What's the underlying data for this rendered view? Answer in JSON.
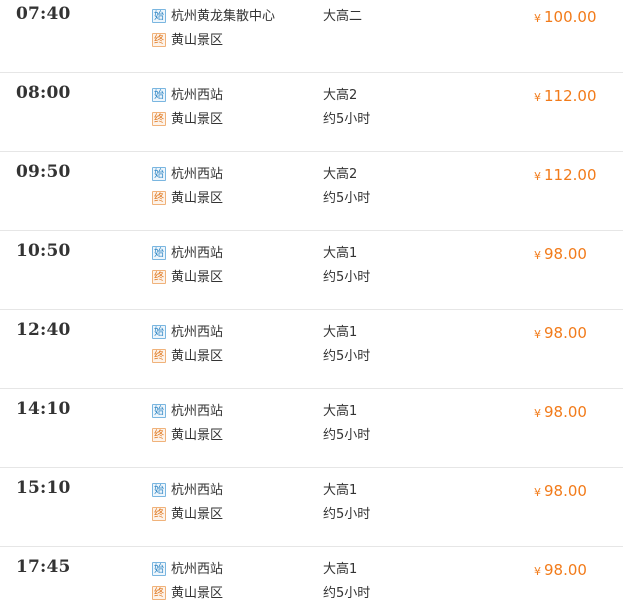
{
  "colors": {
    "price": "#f27b1a",
    "start_badge": "#2f86c4",
    "end_badge": "#e07a23",
    "divider": "#e6e6e6"
  },
  "labels": {
    "start_badge": "始",
    "end_badge": "终",
    "currency": "¥"
  },
  "schedules": [
    {
      "time": "07:40",
      "start": "杭州黄龙集散中心",
      "end": "黄山景区",
      "bus": "大高二",
      "duration": "",
      "price": "100.00"
    },
    {
      "time": "08:00",
      "start": "杭州西站",
      "end": "黄山景区",
      "bus": "大高2",
      "duration": "约5小时",
      "price": "112.00"
    },
    {
      "time": "09:50",
      "start": "杭州西站",
      "end": "黄山景区",
      "bus": "大高2",
      "duration": "约5小时",
      "price": "112.00"
    },
    {
      "time": "10:50",
      "start": "杭州西站",
      "end": "黄山景区",
      "bus": "大高1",
      "duration": "约5小时",
      "price": "98.00"
    },
    {
      "time": "12:40",
      "start": "杭州西站",
      "end": "黄山景区",
      "bus": "大高1",
      "duration": "约5小时",
      "price": "98.00"
    },
    {
      "time": "14:10",
      "start": "杭州西站",
      "end": "黄山景区",
      "bus": "大高1",
      "duration": "约5小时",
      "price": "98.00"
    },
    {
      "time": "15:10",
      "start": "杭州西站",
      "end": "黄山景区",
      "bus": "大高1",
      "duration": "约5小时",
      "price": "98.00"
    },
    {
      "time": "17:45",
      "start": "杭州西站",
      "end": "黄山景区",
      "bus": "大高1",
      "duration": "约5小时",
      "price": "98.00"
    }
  ]
}
